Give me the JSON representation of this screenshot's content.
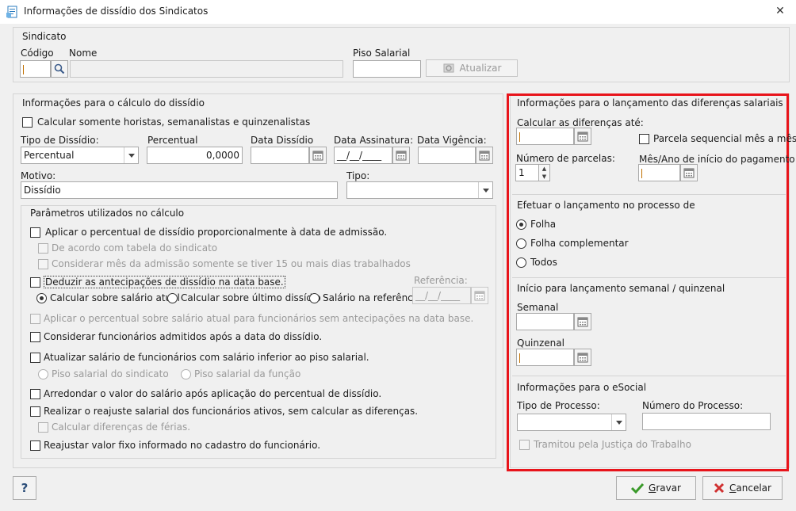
{
  "window": {
    "title": "Informações de dissídio dos Sindicatos"
  },
  "sindicato": {
    "group_title": "Sindicato",
    "codigo_label": "Código",
    "nome_label": "Nome",
    "piso_label": "Piso Salarial",
    "codigo_value": "",
    "nome_value": "",
    "piso_value": "",
    "atualizar_label": "Atualizar"
  },
  "calculo": {
    "group_title": "Informações para o cálculo do dissídio",
    "calcular_somente": "Calcular somente horistas, semanalistas e quinzenalistas",
    "tipo_dissidio_label": "Tipo de Dissídio:",
    "tipo_dissidio_value": "Percentual",
    "percentual_label": "Percentual",
    "percentual_value": "0,0000",
    "data_dissidio_label": "Data Dissídio",
    "data_dissidio_value": "",
    "data_assinatura_label": "Data Assinatura:",
    "data_assinatura_value": "__/__/____",
    "data_vigencia_label": "Data Vigência:",
    "data_vigencia_value": "",
    "motivo_label": "Motivo:",
    "motivo_value": "Dissídio",
    "tipo_label": "Tipo:",
    "tipo_value": ""
  },
  "parametros": {
    "group_title": "Parâmetros utilizados no cálculo",
    "aplicar_proporcional": "Aplicar o percentual de dissídio proporcionalmente à data de admissão.",
    "de_acordo_tabela": "De acordo com tabela do sindicato",
    "considerar_mes_admissao": "Considerar mês da admissão somente se tiver 15 ou mais dias trabalhados",
    "deduzir_antecipacoes": "Deduzir as antecipações de dissídio na data base.",
    "referencia_label": "Referência:",
    "referencia_value": "__/__/____",
    "radio_salario_atual": "Calcular sobre salário atual",
    "radio_ultimo_dissidio": "Calcular sobre último dissídio",
    "radio_salario_referencia": "Salário na referência",
    "aplicar_sem_antecipacoes": "Aplicar o percentual sobre salário atual para funcionários sem antecipações na data base.",
    "considerar_admitidos": "Considerar funcionários admitidos após a data do dissídio.",
    "atualizar_salario_inferior": "Atualizar salário de funcionários com salário inferior ao piso salarial.",
    "piso_sindicato": "Piso salarial do sindicato",
    "piso_funcao": "Piso salarial da função",
    "arredondar": "Arredondar o valor do salário após aplicação do percentual de dissídio.",
    "realizar_reajuste": "Realizar o reajuste salarial dos funcionários ativos, sem calcular as diferenças.",
    "calcular_ferias": "Calcular diferenças de férias.",
    "reajustar_valor_fixo": "Reajustar valor fixo informado no cadastro do funcionário."
  },
  "lancamento": {
    "group_title": "Informações para o lançamento das diferenças salariais",
    "calcular_ate_label": "Calcular as diferenças até:",
    "calcular_ate_value": "",
    "parcela_sequencial": "Parcela sequencial mês a mês",
    "num_parcelas_label": "Número de parcelas:",
    "num_parcelas_value": "1",
    "mes_ano_label": "Mês/Ano de início do pagamento:",
    "mes_ano_value": ""
  },
  "processo": {
    "group_title": "Efetuar o lançamento no processo de",
    "folha": "Folha",
    "folha_complementar": "Folha complementar",
    "todos": "Todos"
  },
  "semanal": {
    "group_title": "Início para lançamento semanal / quinzenal",
    "semanal_label": "Semanal",
    "semanal_value": "",
    "quinzenal_label": "Quinzenal",
    "quinzenal_value": ""
  },
  "esocial": {
    "group_title": "Informações para o eSocial",
    "tipo_processo_label": "Tipo de Processo:",
    "tipo_processo_value": "",
    "numero_processo_label": "Número do Processo:",
    "numero_processo_value": "",
    "tramitou": "Tramitou pela Justiça do Trabalho"
  },
  "footer": {
    "help": "?",
    "gravar_rest": "ravar",
    "gravar_key": "G",
    "cancelar_rest": "ancelar",
    "cancelar_key": "C"
  },
  "colors": {
    "highlight": "#e8141b",
    "gravar_check": "#3a9a2a",
    "cancelar_x": "#d03030"
  }
}
